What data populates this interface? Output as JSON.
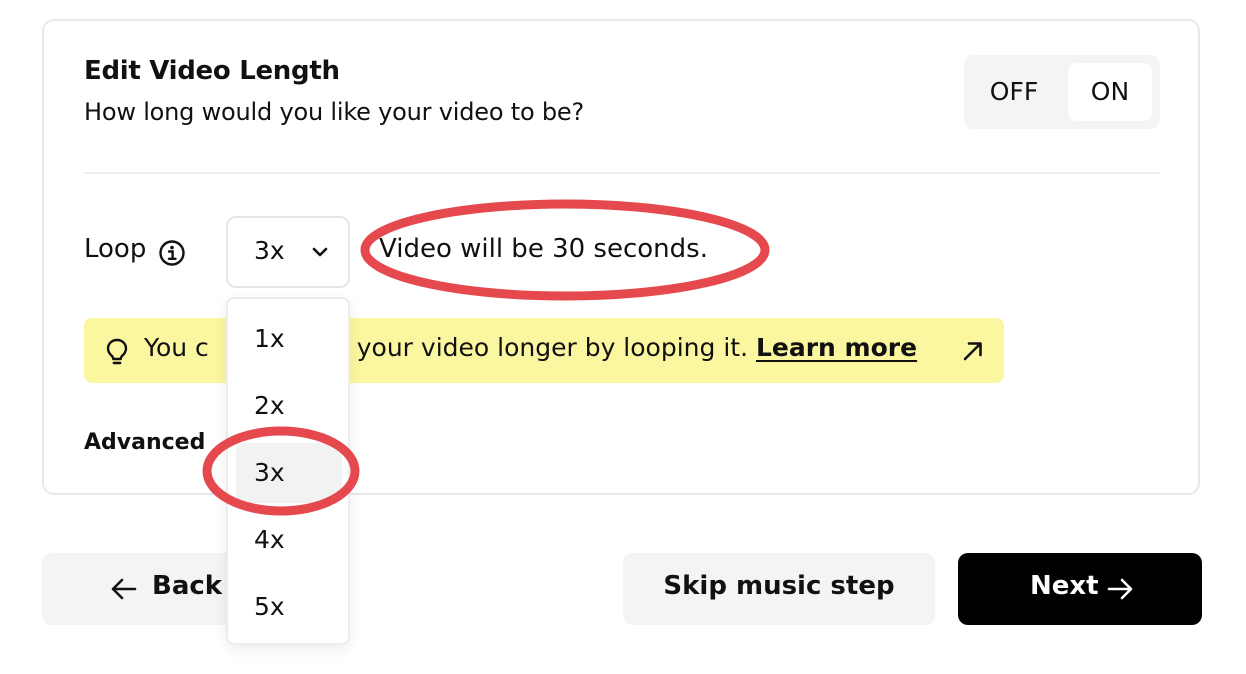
{
  "header": {
    "title": "Edit Video Length",
    "subtitle": "How long would you like your video to be?"
  },
  "toggle": {
    "off_label": "OFF",
    "on_label": "ON",
    "selected": "ON"
  },
  "loop": {
    "label": "Loop",
    "selected_value": "3x",
    "options": [
      "1x",
      "2x",
      "3x",
      "4x",
      "5x"
    ],
    "result_text": "Video will be 30 seconds."
  },
  "hint": {
    "text_before": "You c",
    "text_after": " your video longer by looping it. ",
    "link_label": "Learn more"
  },
  "advanced": {
    "label": "Advanced"
  },
  "footer": {
    "back_label": "Back",
    "skip_label": "Skip music step",
    "next_label": "Next"
  },
  "colors": {
    "accent": "#000000",
    "hint_bg": "#fbf7a0",
    "annotation": "#e5484d"
  },
  "icons": [
    "info-icon",
    "chevron-down-icon",
    "lightbulb-icon",
    "arrow-up-right-icon",
    "arrow-left-icon",
    "arrow-right-icon"
  ]
}
